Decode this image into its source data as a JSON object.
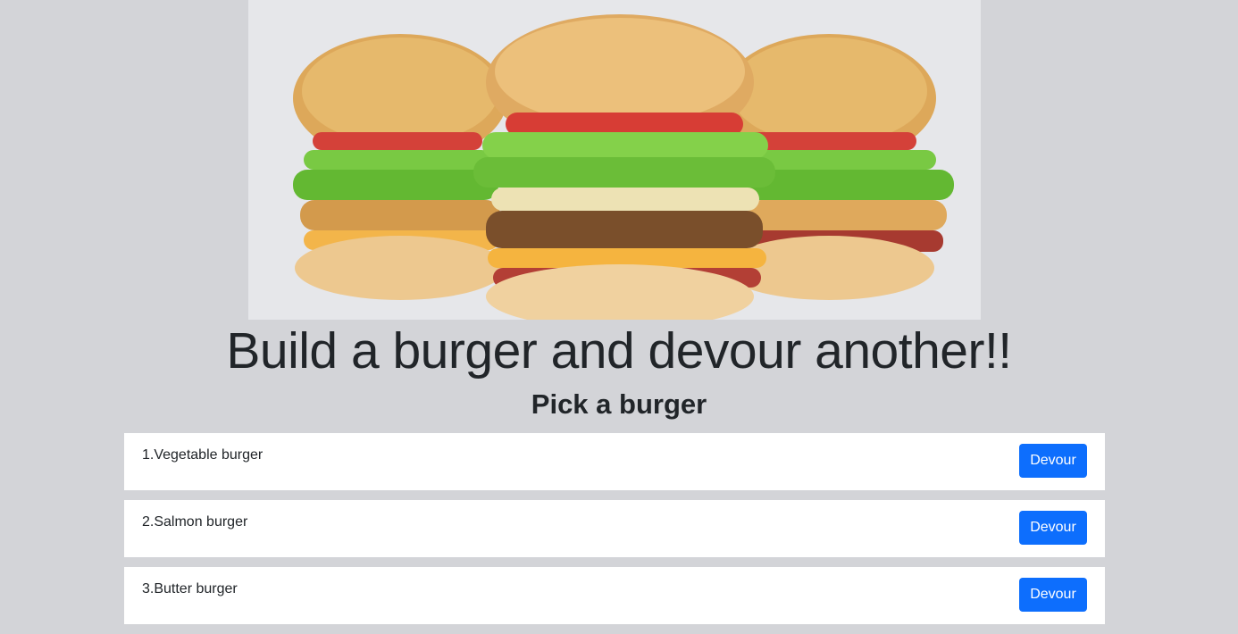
{
  "header": {
    "title": "Build a burger and devour another!!",
    "subtitle": "Pick a burger"
  },
  "hero": {
    "image": "burger-trio-image"
  },
  "burgers": [
    {
      "label": "1.Vegetable burger",
      "action": "Devour"
    },
    {
      "label": "2.Salmon burger",
      "action": "Devour"
    },
    {
      "label": "3.Butter burger",
      "action": "Devour"
    }
  ],
  "colors": {
    "page_background": "#d3d4d8",
    "hero_background": "#e6e7ea",
    "button": "#0d6efd",
    "text": "#212529"
  }
}
